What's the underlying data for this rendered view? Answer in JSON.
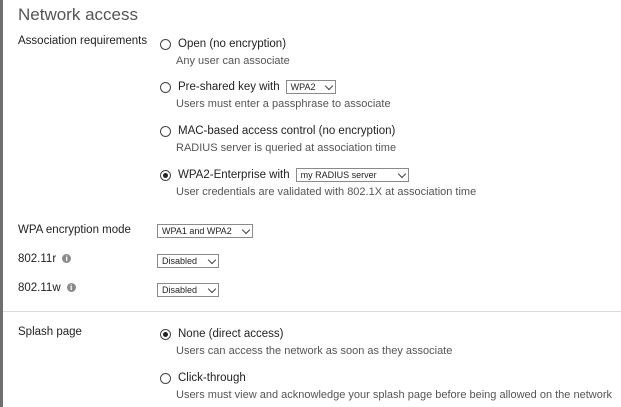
{
  "section": {
    "title": "Network access"
  },
  "association": {
    "label": "Association requirements",
    "options": [
      {
        "label": "Open (no encryption)",
        "desc": "Any user can associate",
        "checked": false
      },
      {
        "label": "Pre-shared key with",
        "select": "WPA2",
        "desc": "Users must enter a passphrase to associate",
        "checked": false
      },
      {
        "label": "MAC-based access control (no encryption)",
        "desc": "RADIUS server is queried at association time",
        "checked": false
      },
      {
        "label": "WPA2-Enterprise with",
        "select": "my RADIUS server",
        "desc": "User credentials are validated with 802.1X at association time",
        "checked": true
      }
    ]
  },
  "wpa_mode": {
    "label": "WPA encryption mode",
    "value": "WPA1 and WPA2"
  },
  "r80211r": {
    "label": "802.11r",
    "value": "Disabled"
  },
  "r80211w": {
    "label": "802.11w",
    "value": "Disabled"
  },
  "splash": {
    "label": "Splash page",
    "options": [
      {
        "label": "None (direct access)",
        "desc": "Users can access the network as soon as they associate",
        "checked": true
      },
      {
        "label": "Click-through",
        "desc": "Users must view and acknowledge your splash page before being allowed on the network",
        "checked": false
      }
    ]
  },
  "icons": {
    "info": "info-icon",
    "chevron": "chevron-down-icon"
  }
}
